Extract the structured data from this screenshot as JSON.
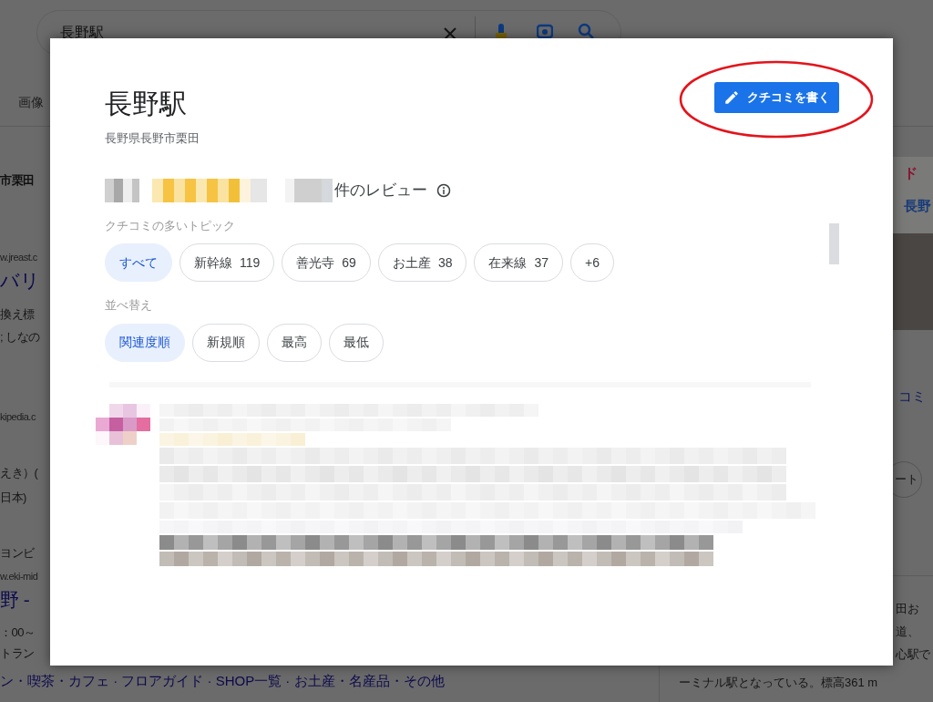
{
  "search": {
    "value": "長野駅"
  },
  "nav_tab": "画像",
  "background_left": [
    {
      "text": "市栗田",
      "kind": "bold"
    },
    {
      "text": "w.jreast.c",
      "kind": "url"
    },
    {
      "text": "バリ",
      "kind": "title"
    },
    {
      "text": "換え標",
      "kind": "text"
    },
    {
      "text": "; しなの",
      "kind": "text"
    },
    {
      "text": "kipedia.c",
      "kind": "url"
    },
    {
      "text": "えき）(",
      "kind": "text"
    },
    {
      "text": "日本)",
      "kind": "text"
    },
    {
      "text": "ヨンビ",
      "kind": "text"
    },
    {
      "text": "w.eki-mid",
      "kind": "url"
    },
    {
      "text": "野 - ",
      "kind": "title"
    },
    {
      "text": "：00～",
      "kind": "text"
    },
    {
      "text": "トラン",
      "kind": "text"
    }
  ],
  "background_bottom_links": "ン・喫茶・カフェ · フロアガイド · SHOP一覧 · お土産・名産品・その他",
  "background_right": {
    "map_labels": [
      {
        "text": "ド",
        "color": "#8a1030"
      },
      {
        "text": "長野",
        "color": "#173a7a"
      }
    ],
    "link": "コミ",
    "button": "ート",
    "lines": [
      "田お",
      "道、",
      "心駅で"
    ],
    "bottom_text": "ーミナル駅となっている。標高361 m"
  },
  "dialog": {
    "title": "長野駅",
    "address": "長野県長野市栗田",
    "review_count_suffix": "件のレビュー",
    "write_review_button": "クチコミを書く",
    "topics_heading": "クチコミの多いトピック",
    "topics": [
      {
        "label": "すべて",
        "selected": true
      },
      {
        "label": "新幹線",
        "count": "119",
        "selected": false
      },
      {
        "label": "善光寺",
        "count": "69",
        "selected": false
      },
      {
        "label": "お土産",
        "count": "38",
        "selected": false
      },
      {
        "label": "在来線",
        "count": "37",
        "selected": false
      },
      {
        "label": "+6",
        "selected": false
      }
    ],
    "sort_heading": "並べ替え",
    "sort_options": [
      {
        "label": "関連度順",
        "selected": true
      },
      {
        "label": "新規順",
        "selected": false
      },
      {
        "label": "最高",
        "selected": false
      },
      {
        "label": "最低",
        "selected": false
      }
    ]
  }
}
